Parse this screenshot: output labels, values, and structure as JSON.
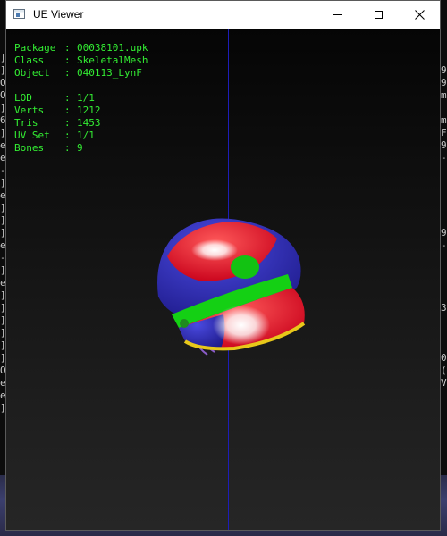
{
  "window": {
    "title": "UE Viewer"
  },
  "info": {
    "package": {
      "key": "Package",
      "value": "00038101.upk"
    },
    "class": {
      "key": "Class",
      "value": "SkeletalMesh"
    },
    "object": {
      "key": "Object",
      "value": "040113_LynF"
    },
    "lod": {
      "key": "LOD",
      "value": "1/1"
    },
    "verts": {
      "key": "Verts",
      "value": "1212"
    },
    "tris": {
      "key": "Tris",
      "value": "1453"
    },
    "uv_set": {
      "key": "UV Set",
      "value": "1/1"
    },
    "bones": {
      "key": "Bones",
      "value": "9"
    },
    "separator": ":"
  },
  "background_console": {
    "left_chars": [
      "]",
      "]",
      "O",
      "O",
      "]",
      "6",
      "]",
      "e",
      "e",
      "-",
      "]",
      "e",
      "]",
      "]",
      "]",
      "e",
      "-",
      "]",
      "e",
      "]",
      "]",
      "]",
      "]",
      "]",
      "]",
      "O",
      "e",
      "e",
      "]"
    ],
    "right_chars": [
      "",
      "9",
      "9",
      "m",
      "",
      "m",
      "F",
      "9",
      "-",
      "",
      "",
      "",
      "",
      "",
      "9",
      "-",
      "",
      "",
      "",
      "",
      "3",
      "",
      "",
      "",
      "0",
      "(",
      "V",
      ""
    ]
  },
  "colors": {
    "info_text": "#33ee33",
    "axis": "#1d1db8",
    "hat_red": "#e8001a",
    "hat_blue": "#2a22b8",
    "hat_green": "#12c212",
    "hat_gold": "#e8c81a",
    "hair_purple": "#8a5cc8"
  }
}
